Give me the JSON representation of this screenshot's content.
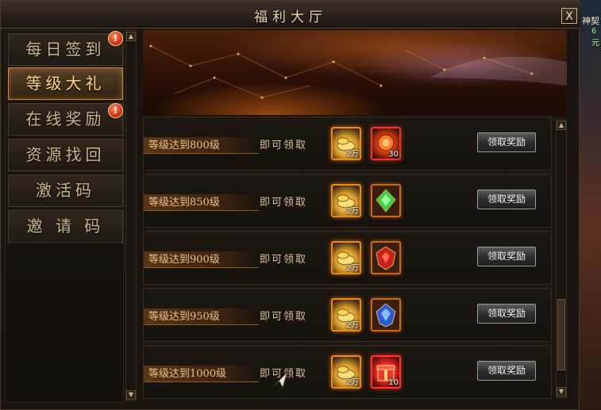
{
  "window": {
    "title": "福利大厅",
    "close_label": "X"
  },
  "background_right": {
    "name_text": "神契",
    "level_text": "6元"
  },
  "sidebar": {
    "items": [
      {
        "label": "每日签到",
        "active": false,
        "badge": "!"
      },
      {
        "label": "等级大礼",
        "active": true,
        "badge": ""
      },
      {
        "label": "在线奖励",
        "active": false,
        "badge": "!"
      },
      {
        "label": "资源找回",
        "active": false,
        "badge": ""
      },
      {
        "label": "激活码",
        "active": false,
        "badge": ""
      },
      {
        "label": "邀 请 码",
        "active": false,
        "badge": ""
      }
    ]
  },
  "rewards": {
    "hint": "即可领取",
    "claim_label": "领取奖励",
    "rows": [
      {
        "condition": "等级达到800级",
        "items": [
          {
            "icon": "gold-ingot-icon",
            "qty": "2万"
          },
          {
            "icon": "red-gem-icon",
            "qty": "30"
          }
        ]
      },
      {
        "condition": "等级达到850级",
        "items": [
          {
            "icon": "gold-ingot-icon",
            "qty": "2万"
          },
          {
            "icon": "green-crystal-icon",
            "qty": ""
          }
        ]
      },
      {
        "condition": "等级达到900级",
        "items": [
          {
            "icon": "gold-ingot-icon",
            "qty": "2万"
          },
          {
            "icon": "red-shield-icon",
            "qty": ""
          }
        ]
      },
      {
        "condition": "等级达到950级",
        "items": [
          {
            "icon": "gold-ingot-icon",
            "qty": "2万"
          },
          {
            "icon": "blue-crystal-icon",
            "qty": ""
          }
        ]
      },
      {
        "condition": "等级达到1000级",
        "items": [
          {
            "icon": "gold-ingot-icon",
            "qty": "2万"
          },
          {
            "icon": "gift-box-icon",
            "qty": "10"
          }
        ]
      }
    ]
  }
}
